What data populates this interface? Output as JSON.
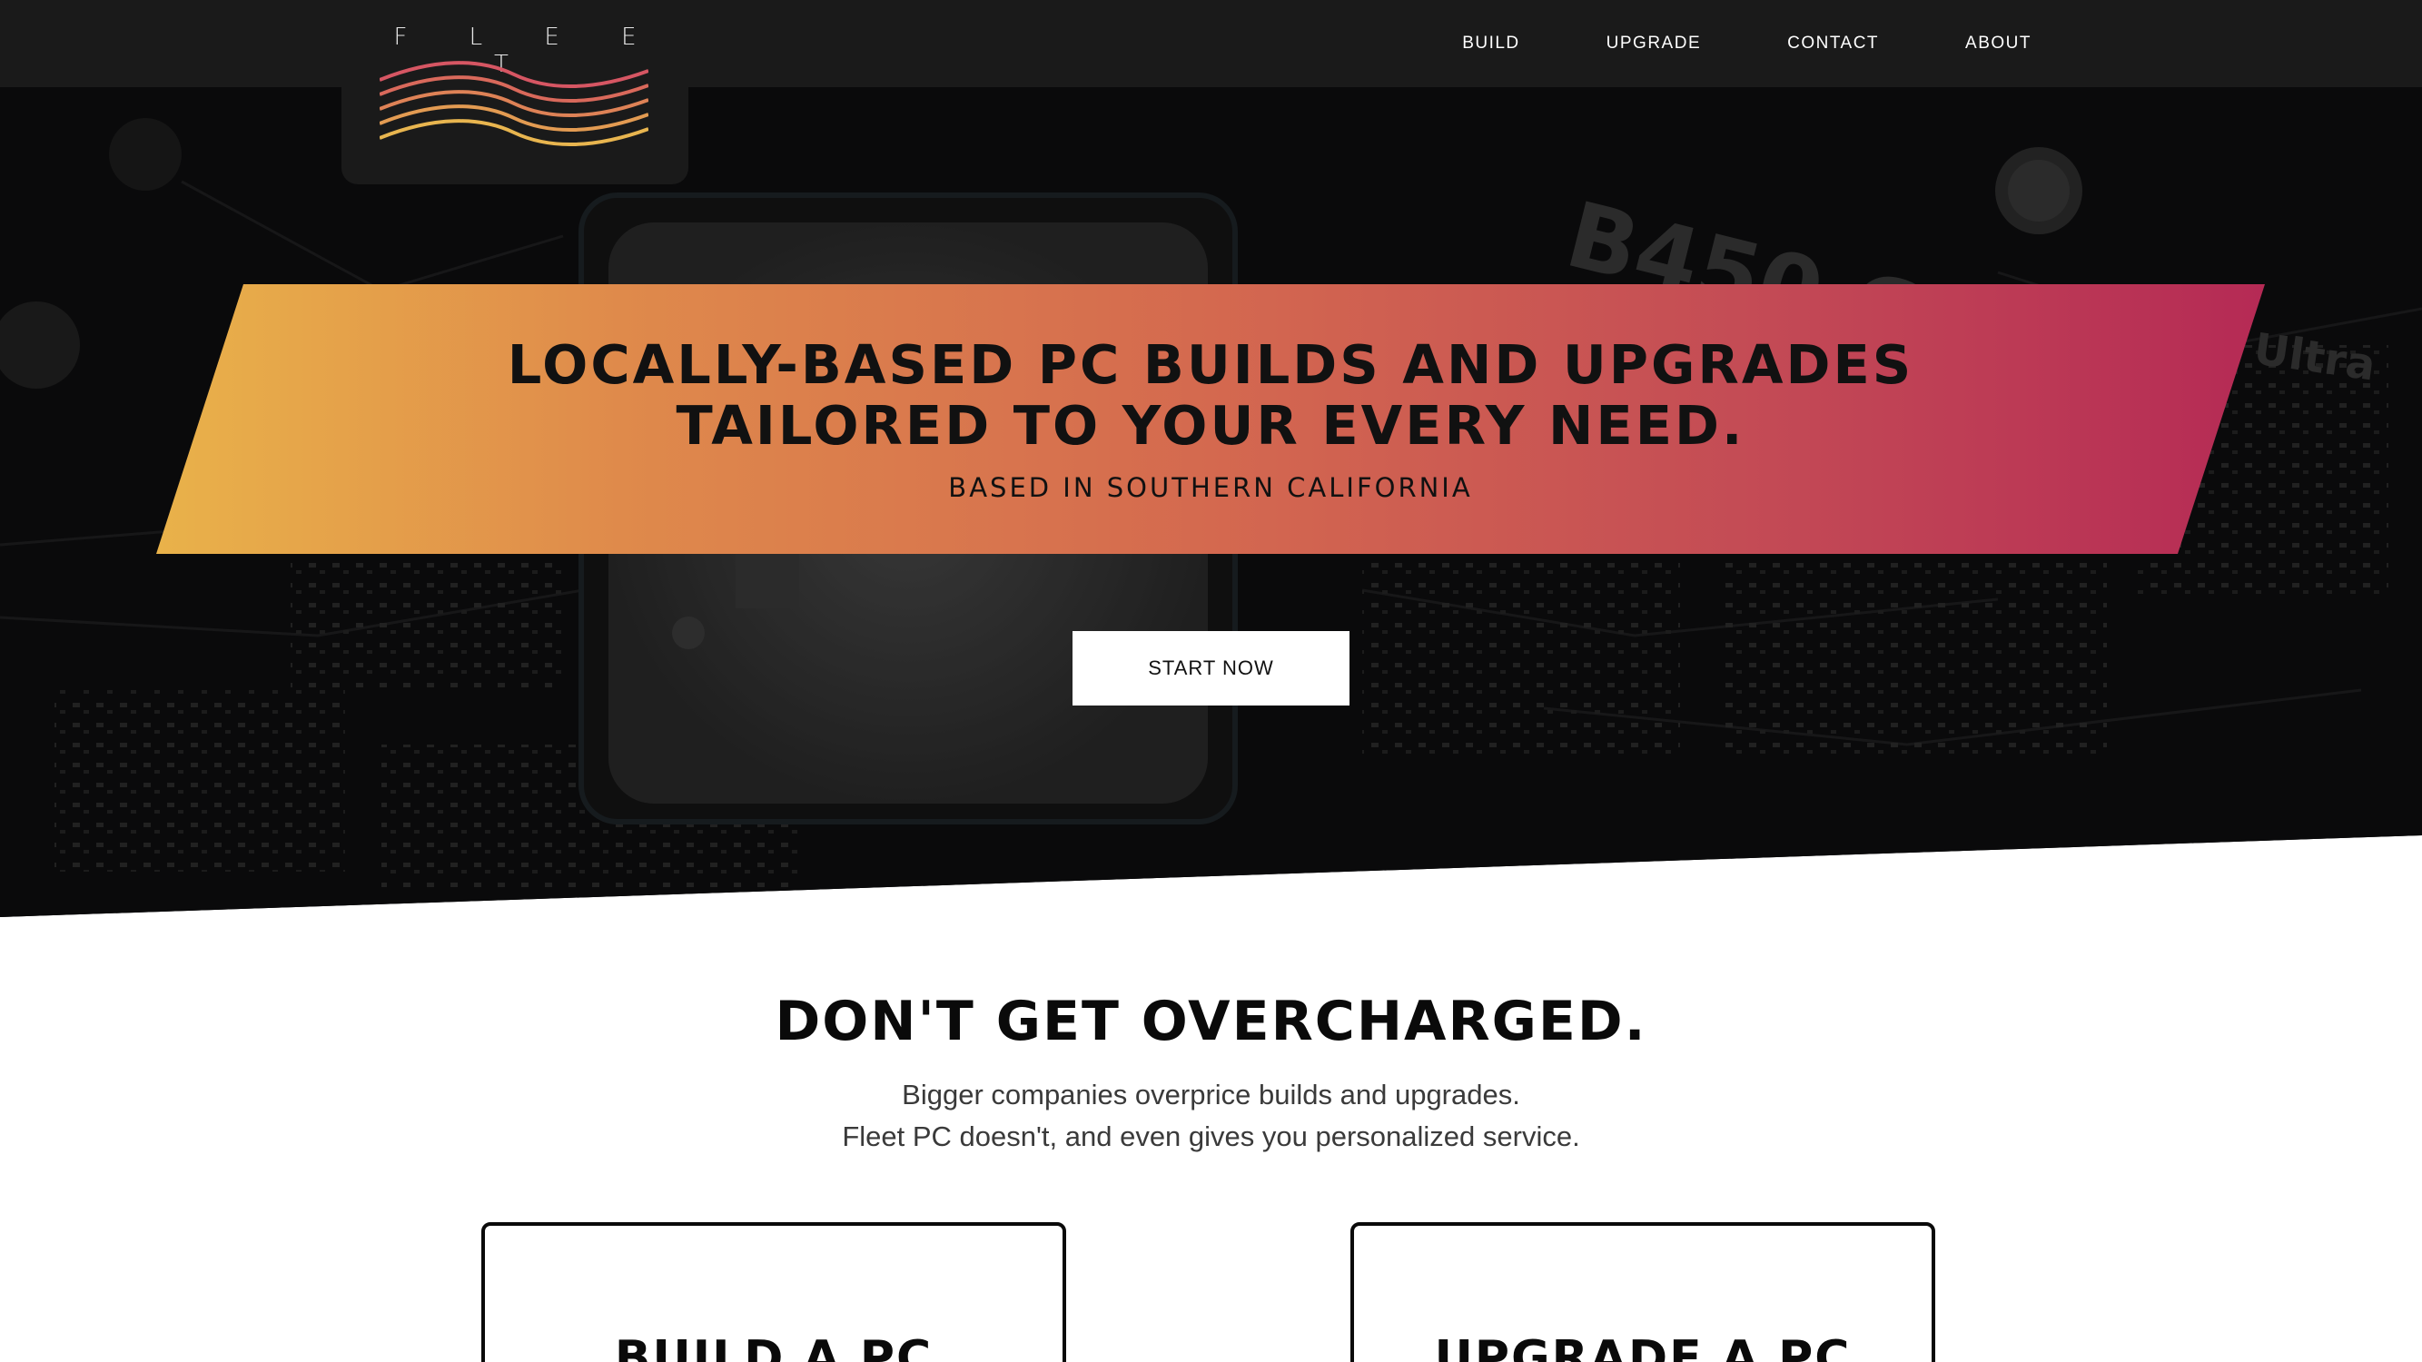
{
  "brand": {
    "logo_text": "F L E E T",
    "wave_colors": [
      "#d65663",
      "#d9695b",
      "#de8256",
      "#e39b52",
      "#e8b54f"
    ]
  },
  "nav": {
    "items": [
      {
        "label": "BUILD"
      },
      {
        "label": "UPGRADE"
      },
      {
        "label": "CONTACT"
      },
      {
        "label": "ABOUT"
      }
    ]
  },
  "hero": {
    "headline_line1": "LOCALLY-BASED PC BUILDS AND UPGRADES",
    "headline_line2": "TAILORED TO YOUR EVERY NEED.",
    "subheadline": "BASED IN SOUTHERN CALIFORNIA",
    "cta_label": "START NOW",
    "background_labels": [
      "B450 Gaming",
      "Ultra"
    ],
    "colors": {
      "gradient_start": "#e9b24a",
      "gradient_end": "#b52a55"
    }
  },
  "section": {
    "title": "DON'T GET OVERCHARGED.",
    "text_line1": "Bigger companies overprice builds and upgrades.",
    "text_line2": "Fleet PC doesn't, and even gives you personalized service."
  },
  "cards": [
    {
      "title": "BUILD A PC"
    },
    {
      "title": "UPGRADE A PC"
    }
  ]
}
